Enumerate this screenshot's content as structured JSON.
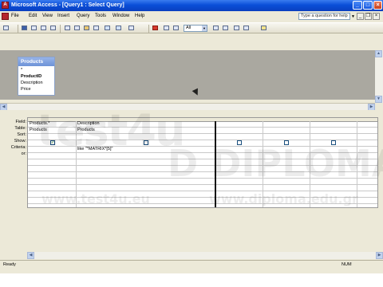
{
  "window": {
    "title": "Microsoft Access - [Query1 : Select Query]",
    "app_icon": "access-icon",
    "controls": [
      "minimize-icon",
      "maximize-icon",
      "close-icon"
    ]
  },
  "menubar": {
    "items": [
      "File",
      "Edit",
      "View",
      "Insert",
      "Query",
      "Tools",
      "Window",
      "Help"
    ],
    "help_placeholder": "Type a question for help",
    "mdi_controls": [
      "minimize-icon",
      "restore-icon",
      "close-icon"
    ]
  },
  "toolbar": {
    "top_values_combo": "All"
  },
  "table_pane": {
    "table_name": "Products",
    "fields": [
      "*",
      "ProductID",
      "Description",
      "Price"
    ]
  },
  "design_grid": {
    "row_labels": [
      "Field:",
      "Table:",
      "Sort:",
      "Show:",
      "Criteria:",
      "or:"
    ],
    "columns": [
      {
        "field": "Products.*",
        "table": "Products",
        "sort": "",
        "show": true,
        "criteria": ""
      },
      {
        "field": "Description",
        "table": "Products",
        "sort": "",
        "show": false,
        "criteria": "like \"*MATRIX*[5]\""
      },
      {
        "field": "",
        "table": "",
        "sort": "",
        "show": false,
        "criteria": ""
      },
      {
        "field": "",
        "table": "",
        "sort": "",
        "show": false,
        "criteria": ""
      },
      {
        "field": "",
        "table": "",
        "sort": "",
        "show": false,
        "criteria": ""
      },
      {
        "field": "",
        "table": "",
        "sort": "",
        "show": false,
        "criteria": ""
      },
      {
        "field": "",
        "table": "",
        "sort": "",
        "show": false,
        "criteria": ""
      }
    ]
  },
  "statusbar": {
    "status": "Ready",
    "indicator": "NUM"
  },
  "watermarks": {
    "left_logo": "test4u",
    "right_logo": "D DIPLOMA",
    "left_url": "www.test4u.eu",
    "right_url": "www.diploma.edu.gr"
  }
}
